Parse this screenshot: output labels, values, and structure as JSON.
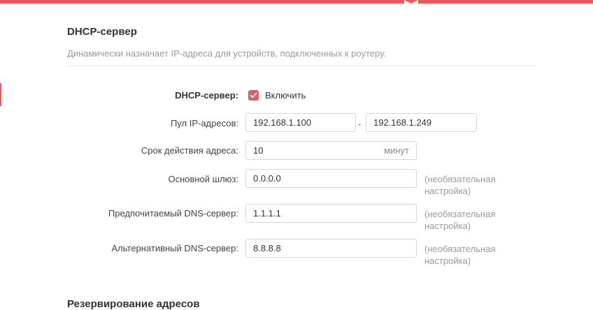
{
  "colors": {
    "accent": "#e45a5e",
    "text": "#333333",
    "muted": "#9a9a9a",
    "border": "#d6d6d6"
  },
  "dhcp_section": {
    "title": "DHCP-сервер",
    "description": "Динамически назначает IP-адреса для устройств, подключенных к роутеру."
  },
  "form": {
    "dhcp_server": {
      "label": "DHCP-сервер:",
      "checkbox_checked": true,
      "checkbox_label": "Включить"
    },
    "ip_pool": {
      "label": "Пул IP-адресов:",
      "start": "192.168.1.100",
      "separator": "-",
      "end": "192.168.1.249"
    },
    "lease_time": {
      "label": "Срок действия адреса:",
      "value": "10",
      "unit": "минут"
    },
    "gateway": {
      "label": "Основной шлюз:",
      "value": "0.0.0.0",
      "hint_line1": "(необязательная",
      "hint_line2": "настройка)"
    },
    "primary_dns": {
      "label": "Предпочитаемый DNS-сервер:",
      "value": "1.1.1.1",
      "hint_line1": "(необязательная",
      "hint_line2": "настройка)"
    },
    "secondary_dns": {
      "label": "Альтернативный DNS-сервер:",
      "value": "8.8.8.8",
      "hint_line1": "(необязательная",
      "hint_line2": "настройка)"
    }
  },
  "reservation_section": {
    "title": "Резервирование адресов"
  }
}
